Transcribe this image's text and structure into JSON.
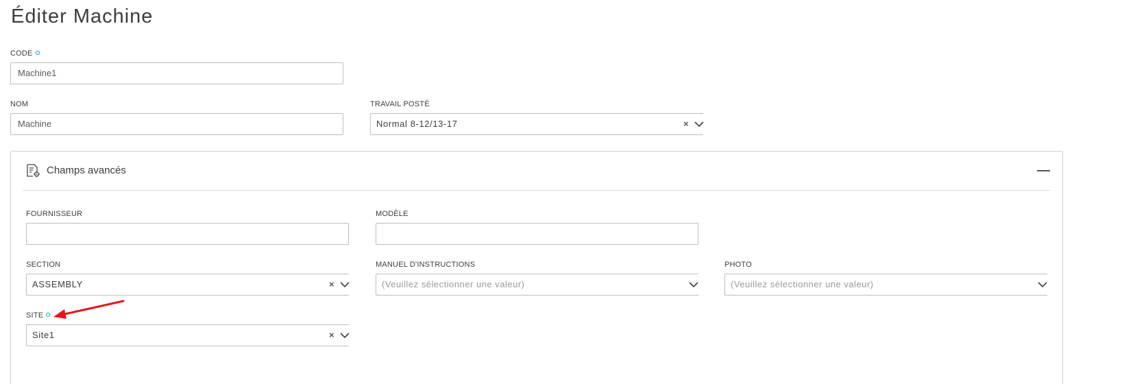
{
  "page": {
    "title": "Éditer Machine"
  },
  "fields": {
    "code": {
      "label": "CODE",
      "value": "Machine1"
    },
    "nom": {
      "label": "NOM",
      "value": "Machine"
    },
    "travail_poste": {
      "label": "TRAVAIL POSTÉ",
      "value": "Normal 8-12/13-17"
    }
  },
  "advanced": {
    "title": "Champs avancés",
    "fournisseur": {
      "label": "FOURNISSEUR",
      "value": ""
    },
    "modele": {
      "label": "MODÈLE",
      "value": ""
    },
    "section": {
      "label": "SECTION",
      "value": "ASSEMBLY"
    },
    "manuel": {
      "label": "MANUEL D'INSTRUCTIONS",
      "placeholder": "(Veuillez sélectionner une valeur)"
    },
    "photo": {
      "label": "PHOTO",
      "placeholder": "(Veuillez sélectionner une valeur)"
    },
    "site": {
      "label": "SITE",
      "value": "Site1"
    }
  },
  "icons": {
    "required": "required-indicator-icon",
    "clear": "clear-icon",
    "dropdown": "chevron-down-icon",
    "collapse": "collapse-icon",
    "panel": "advanced-fields-icon",
    "annotation": "red-arrow-annotation"
  },
  "colors": {
    "required_dot": "#0696d7",
    "annotation_arrow": "#e8141b",
    "border": "#bdbdbd"
  }
}
